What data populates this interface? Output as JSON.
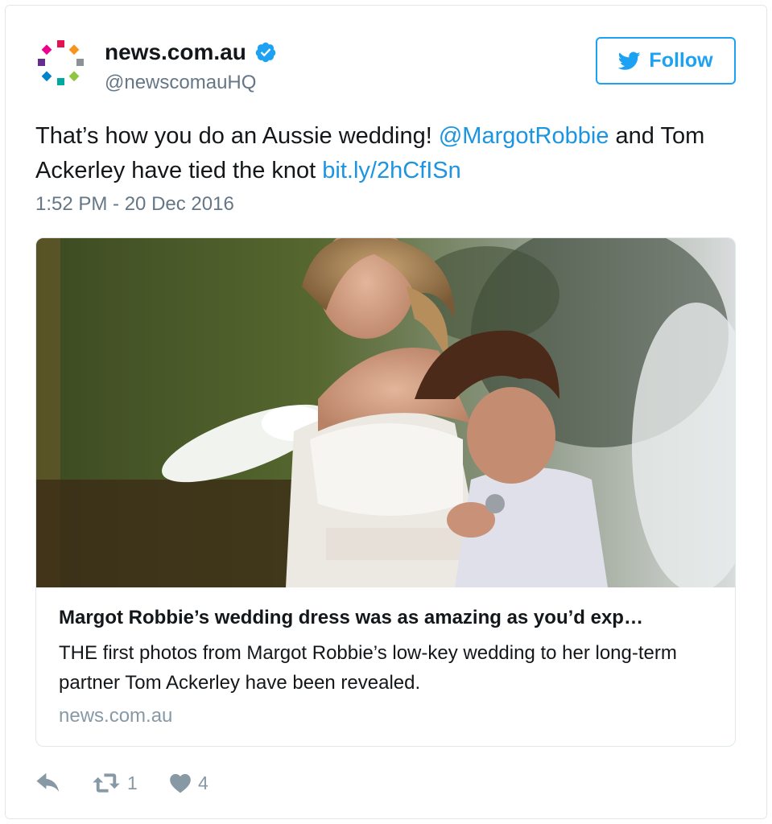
{
  "account": {
    "name": "news.com.au",
    "handle": "@newscomauHQ",
    "verified": true
  },
  "follow_label": "Follow",
  "tweet": {
    "text_1": "That’s how you do an Aussie wedding! ",
    "mention": "@MargotRobbie",
    "text_2": " and Tom Ackerley have tied the knot ",
    "link": "bit.ly/2hCfISn",
    "timestamp": "1:52 PM - 20 Dec 2016"
  },
  "card": {
    "title": "Margot Robbie’s wedding dress was as amazing as you’d exp…",
    "description": "THE first photos from Margot Robbie’s low-key wedding to her long-term partner Tom Ackerley have been revealed.",
    "domain": "news.com.au"
  },
  "actions": {
    "reply_icon": "reply-icon",
    "retweet_icon": "retweet-icon",
    "retweet_count": "1",
    "like_icon": "heart-icon",
    "like_count": "4"
  },
  "colors": {
    "accent": "#1da1f2",
    "link": "#1b95e0",
    "muted": "#657786"
  }
}
